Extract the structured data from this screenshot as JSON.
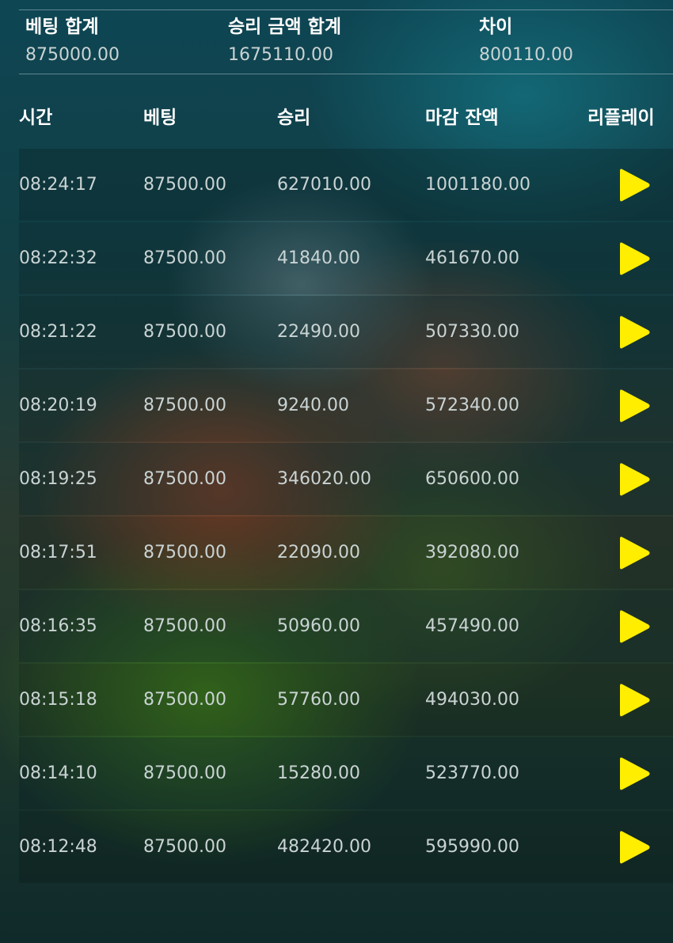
{
  "summary": {
    "total_bet_label": "베팅 합계",
    "total_bet_value": "875000.00",
    "total_win_label": "승리 금액 합계",
    "total_win_value": "1675110.00",
    "diff_label": "차이",
    "diff_value": "800110.00"
  },
  "columns": {
    "time": "시간",
    "bet": "베팅",
    "win": "승리",
    "balance": "마감 잔액",
    "replay": "리플레이"
  },
  "rows": [
    {
      "time": "08:24:17",
      "bet": "87500.00",
      "win": "627010.00",
      "balance": "1001180.00",
      "replay_icon": "play-icon"
    },
    {
      "time": "08:22:32",
      "bet": "87500.00",
      "win": "41840.00",
      "balance": "461670.00",
      "replay_icon": "play-icon"
    },
    {
      "time": "08:21:22",
      "bet": "87500.00",
      "win": "22490.00",
      "balance": "507330.00",
      "replay_icon": "play-icon"
    },
    {
      "time": "08:20:19",
      "bet": "87500.00",
      "win": "9240.00",
      "balance": "572340.00",
      "replay_icon": "play-icon"
    },
    {
      "time": "08:19:25",
      "bet": "87500.00",
      "win": "346020.00",
      "balance": "650600.00",
      "replay_icon": "play-icon"
    },
    {
      "time": "08:17:51",
      "bet": "87500.00",
      "win": "22090.00",
      "balance": "392080.00",
      "replay_icon": "play-icon"
    },
    {
      "time": "08:16:35",
      "bet": "87500.00",
      "win": "50960.00",
      "balance": "457490.00",
      "replay_icon": "play-icon"
    },
    {
      "time": "08:15:18",
      "bet": "87500.00",
      "win": "57760.00",
      "balance": "494030.00",
      "replay_icon": "play-icon"
    },
    {
      "time": "08:14:10",
      "bet": "87500.00",
      "win": "15280.00",
      "balance": "523770.00",
      "replay_icon": "play-icon"
    },
    {
      "time": "08:12:48",
      "bet": "87500.00",
      "win": "482420.00",
      "balance": "595990.00",
      "replay_icon": "play-icon"
    }
  ],
  "colors": {
    "play_icon": "#ffee00",
    "label_text": "#ffffff",
    "value_text": "#c9d3d3"
  }
}
